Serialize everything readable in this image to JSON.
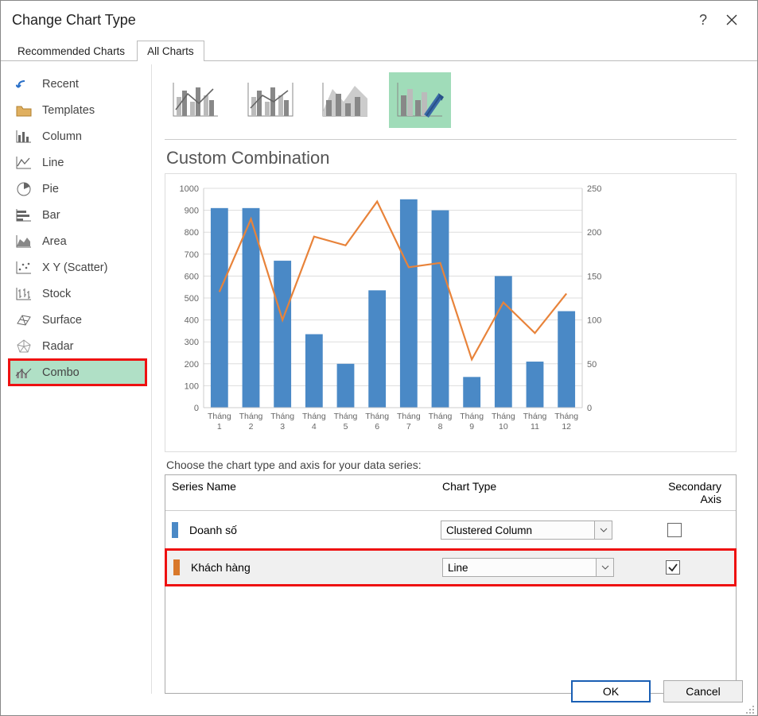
{
  "titlebar": {
    "title": "Change Chart Type"
  },
  "tabs": {
    "recommended": "Recommended Charts",
    "all": "All Charts"
  },
  "sidebar": {
    "items": [
      {
        "label": "Recent"
      },
      {
        "label": "Templates"
      },
      {
        "label": "Column"
      },
      {
        "label": "Line"
      },
      {
        "label": "Pie"
      },
      {
        "label": "Bar"
      },
      {
        "label": "Area"
      },
      {
        "label": "X Y (Scatter)"
      },
      {
        "label": "Stock"
      },
      {
        "label": "Surface"
      },
      {
        "label": "Radar"
      },
      {
        "label": "Combo"
      }
    ]
  },
  "preview_title": "Custom Combination",
  "series_section": {
    "instruction": "Choose the chart type and axis for your data series:",
    "headers": {
      "name": "Series Name",
      "type": "Chart Type",
      "axis": "Secondary Axis"
    },
    "rows": [
      {
        "name": "Doanh số",
        "chart_type": "Clustered Column",
        "secondary_axis": false,
        "swatch_color": "#4a89c6"
      },
      {
        "name": "Khách hàng",
        "chart_type": "Line",
        "secondary_axis": true,
        "swatch_color": "#d9782a"
      }
    ]
  },
  "buttons": {
    "ok": "OK",
    "cancel": "Cancel"
  },
  "chart_data": {
    "type": "combo",
    "categories": [
      "Tháng 1",
      "Tháng 2",
      "Tháng 3",
      "Tháng 4",
      "Tháng 5",
      "Tháng 6",
      "Tháng 7",
      "Tháng 8",
      "Tháng 9",
      "Tháng 10",
      "Tháng 11",
      "Tháng 12"
    ],
    "primary_axis": {
      "min": 0,
      "max": 1000,
      "step": 100
    },
    "secondary_axis": {
      "min": 0,
      "max": 250,
      "step": 50
    },
    "series": [
      {
        "name": "Doanh số",
        "type": "bar",
        "axis": "primary",
        "color": "#4a89c6",
        "values": [
          910,
          910,
          670,
          335,
          200,
          535,
          950,
          900,
          140,
          600,
          210,
          440
        ]
      },
      {
        "name": "Khách hàng",
        "type": "line",
        "axis": "secondary",
        "color": "#e8833a",
        "values": [
          132,
          215,
          100,
          195,
          185,
          235,
          160,
          165,
          55,
          120,
          85,
          130
        ]
      }
    ]
  }
}
